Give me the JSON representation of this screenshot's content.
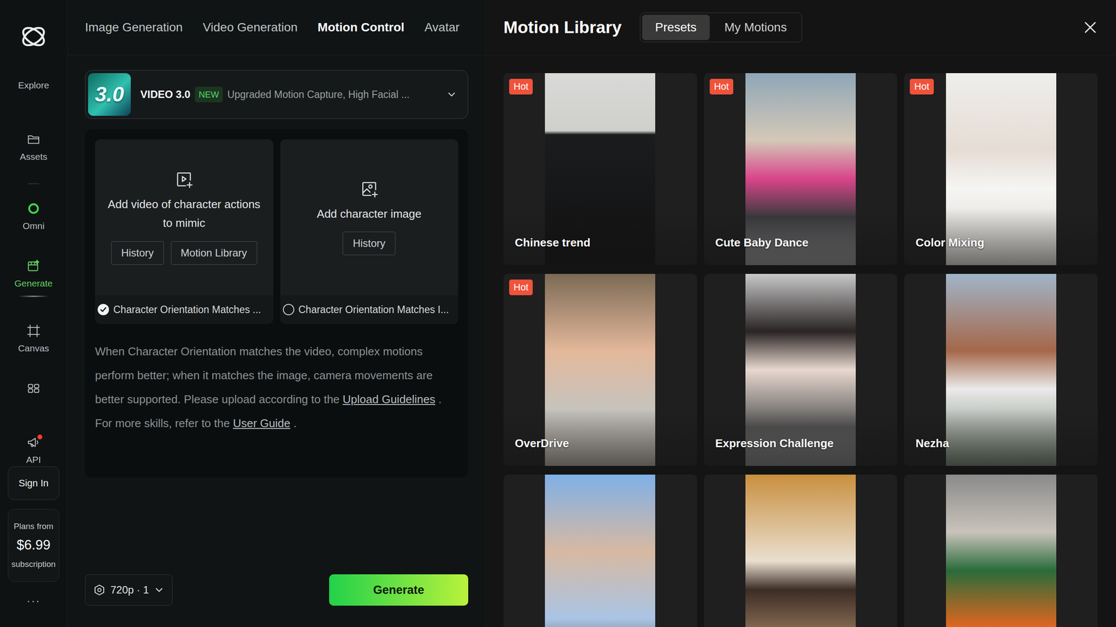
{
  "sidebar": {
    "items": [
      {
        "label": "Explore",
        "selected": false,
        "notification": false
      },
      {
        "label": "Assets",
        "selected": false,
        "notification": false
      },
      {
        "label": "Omni",
        "selected": false,
        "notification": false
      },
      {
        "label": "Generate",
        "selected": true,
        "notification": false
      },
      {
        "label": "Canvas",
        "selected": false,
        "notification": false
      },
      {
        "selected": false,
        "notification": false
      },
      {
        "label": "API",
        "selected": false,
        "notification": true
      }
    ],
    "sign_in": "Sign In",
    "plan": {
      "prefix": "Plans from",
      "price": "$6.99",
      "suffix": "subscription"
    },
    "more": "···"
  },
  "tabs": [
    {
      "label": "Image Generation",
      "selected": false
    },
    {
      "label": "Video Generation",
      "selected": false
    },
    {
      "label": "Motion Control",
      "selected": true
    },
    {
      "label": "Avatar",
      "selected": false
    }
  ],
  "model": {
    "badge": "3.0",
    "name": "VIDEO 3.0",
    "tag": "NEW",
    "description": "Upgraded Motion Capture, High Facial ...",
    "expanded": false
  },
  "uploads": [
    {
      "title": "Add video of character actions to mimic",
      "buttons": [
        "History",
        "Motion Library"
      ]
    },
    {
      "title": "Add character image",
      "buttons": [
        "History"
      ]
    }
  ],
  "orientation": [
    {
      "label": "Character Orientation Matches ...",
      "selected": true
    },
    {
      "label": "Character Orientation Matches I...",
      "selected": false
    }
  ],
  "info": [
    {
      "text": "When Character Orientation matches the video, complex motions perform better; when it matches the image, camera movements are better supported. Please upload according to the ",
      "kind": "text"
    },
    {
      "text": "Upload Guidelines",
      "kind": "link"
    },
    {
      "text": " . For more skills, refer to the ",
      "kind": "text"
    },
    {
      "text": "User Guide",
      "kind": "link"
    },
    {
      "text": " .",
      "kind": "text"
    }
  ],
  "output": {
    "quality": "720p · 1"
  },
  "generate": "Generate",
  "library": {
    "title": "Motion Library",
    "segments": [
      {
        "label": "Presets",
        "selected": true
      },
      {
        "label": "My Motions",
        "selected": false
      }
    ],
    "motions": [
      {
        "name": "Chinese trend",
        "hot": true
      },
      {
        "name": "Cute Baby Dance",
        "hot": true
      },
      {
        "name": "Color Mixing",
        "hot": true
      },
      {
        "name": "OverDrive",
        "hot": true
      },
      {
        "name": "Expression Challenge",
        "hot": false
      },
      {
        "name": "Nezha",
        "hot": false
      },
      {
        "hot": false
      },
      {
        "hot": false
      },
      {
        "hot": false
      }
    ]
  }
}
